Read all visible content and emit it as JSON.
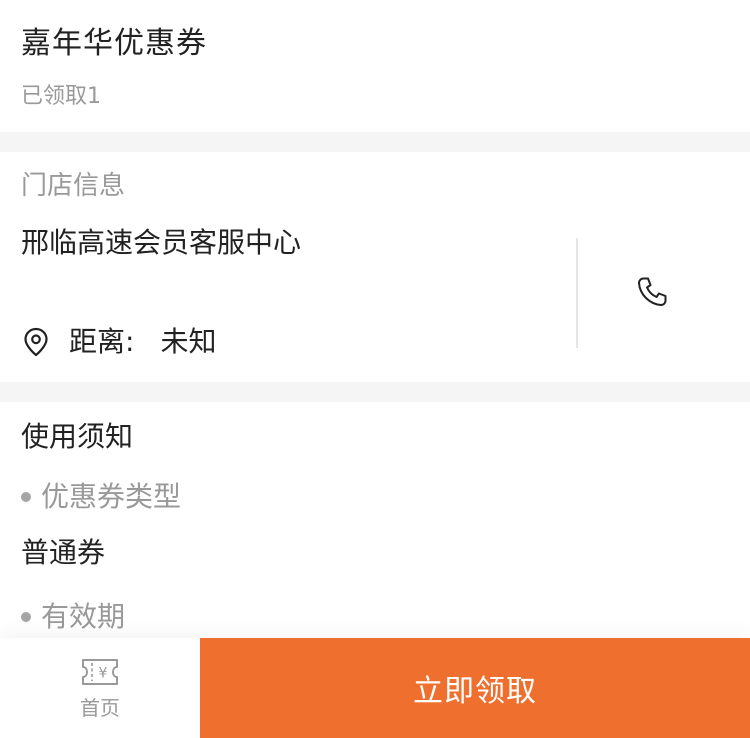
{
  "coupon": {
    "name": "嘉年华优惠券",
    "claimed_text": "已领取1"
  },
  "store": {
    "section_label": "门店信息",
    "name": "邢临高速会员客服中心",
    "distance_label": "距离:",
    "distance_value": "未知",
    "icons": {
      "location": "location-pin-icon",
      "phone": "phone-icon"
    }
  },
  "notice": {
    "title": "使用须知",
    "items": [
      {
        "label": "优惠券类型",
        "value": "普通券"
      },
      {
        "label": "有效期",
        "value": ""
      }
    ]
  },
  "bottom_bar": {
    "home_label": "首页",
    "home_icon": "coupon-ticket-icon",
    "claim_button": "立即领取"
  },
  "colors": {
    "accent": "#ef6f2e",
    "text_primary": "#222222",
    "text_secondary": "#999999",
    "background": "#f5f5f5"
  }
}
